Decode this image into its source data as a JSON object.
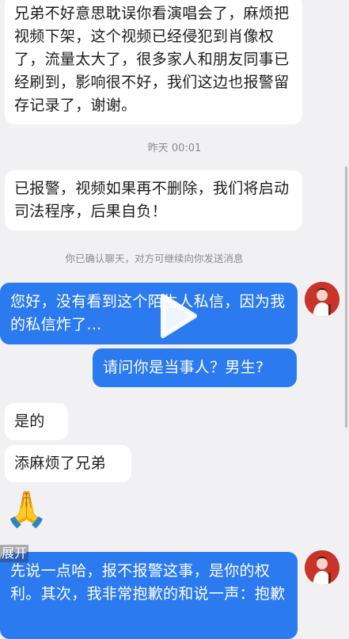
{
  "messages": {
    "m1": "兄弟不好意思耽误你看演唱会了，麻烦把视频下架，这个视频已经侵犯到肖像权了，流量太大了，很多家人和朋友同事已经刷到，影响很不好，我们这边也报警留存记录了，谢谢。",
    "timestamp": "昨天 00:01",
    "m2": "已报警，视频如果再不删除，我们将启动司法程序，后果自负！",
    "system_note": "你已确认聊天，对方可继续向你发送消息",
    "m3": "您好，没有看到这个陌生人私信，因为我的私信炸了...",
    "m4": "请问你是当事人？男生?",
    "m5": "是的",
    "m6": "添麻烦了兄弟",
    "m7": "🙏",
    "m8": "先说一点哈，报不报警这事，是你的权利。其次，我非常抱歉的和说一声：抱歉"
  },
  "overlay": {
    "expand_label": "展开",
    "play_icon": "play-icon"
  },
  "colors": {
    "background": "#f1f1f3",
    "incoming_bubble": "#ffffff",
    "outgoing_bubble": "#2b7af0"
  }
}
